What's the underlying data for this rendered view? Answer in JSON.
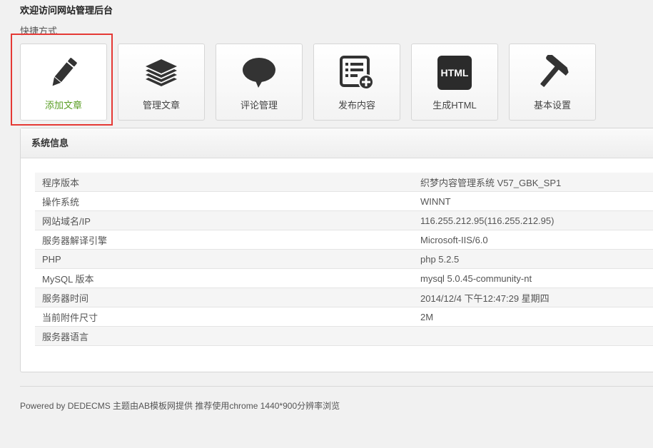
{
  "header": {
    "title": "欢迎访问网站管理后台",
    "shortcuts_label": "快捷方式"
  },
  "shortcuts": [
    {
      "label": "添加文章",
      "icon": "pencil-icon",
      "active": true
    },
    {
      "label": "管理文章",
      "icon": "stack-icon"
    },
    {
      "label": "评论管理",
      "icon": "speech-bubble-icon"
    },
    {
      "label": "发布内容",
      "icon": "list-add-icon"
    },
    {
      "label": "生成HTML",
      "icon": "html-icon",
      "icon_text": "HTML"
    },
    {
      "label": "基本设置",
      "icon": "hammer-icon"
    }
  ],
  "system_info": {
    "title": "系统信息",
    "rows": [
      {
        "key": "程序版本",
        "value": "织梦内容管理系统 V57_GBK_SP1"
      },
      {
        "key": "操作系统",
        "value": "WINNT"
      },
      {
        "key": "网站域名/IP",
        "value": "116.255.212.95(116.255.212.95)"
      },
      {
        "key": "服务器解译引擎",
        "value": "Microsoft-IIS/6.0"
      },
      {
        "key": "PHP",
        "value": "php 5.2.5"
      },
      {
        "key": "MySQL 版本",
        "value": "mysql 5.0.45-community-nt"
      },
      {
        "key": "服务器时间",
        "value": "2014/12/4 下午12:47:29 星期四"
      },
      {
        "key": "当前附件尺寸",
        "value": "2M"
      },
      {
        "key": "服务器语言",
        "value": ""
      }
    ]
  },
  "footer": {
    "text": "Powered by DEDECMS 主题由AB模板网提供 推荐使用chrome 1440*900分辨率浏览"
  },
  "colors": {
    "active_label": "#5a9e24",
    "highlight": "#e53935",
    "icon": "#333333"
  }
}
